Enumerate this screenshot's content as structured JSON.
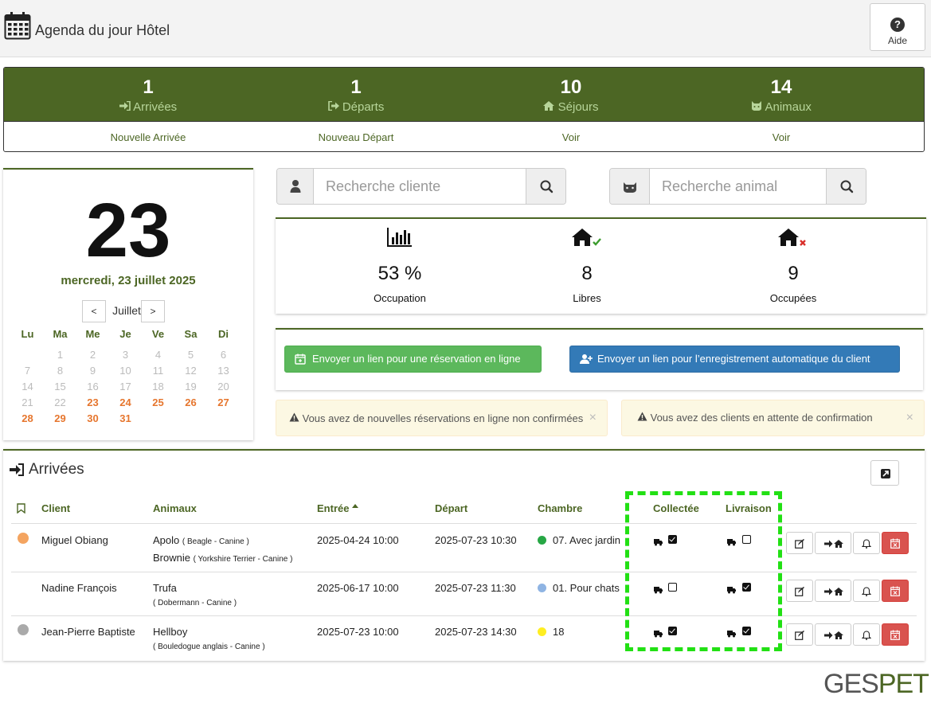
{
  "header": {
    "title": "Agenda du jour Hôtel",
    "help_label": "Aide"
  },
  "stats": [
    {
      "count": "1",
      "label": "Arrivées",
      "link": "Nouvelle Arrivée",
      "icon": "sign-in-icon"
    },
    {
      "count": "1",
      "label": "Départs",
      "link": "Nouveau Départ",
      "icon": "sign-out-icon"
    },
    {
      "count": "10",
      "label": "Séjours",
      "link": "Voir",
      "icon": "home-icon"
    },
    {
      "count": "14",
      "label": "Animaux",
      "link": "Voir",
      "icon": "cat-icon"
    }
  ],
  "calendar": {
    "big_day": "23",
    "full_date": "mercredi, 23 juillet 2025",
    "month": "Juillet",
    "prev": "<",
    "next": ">",
    "weekdays": [
      "Lu",
      "Ma",
      "Me",
      "Je",
      "Ve",
      "Sa",
      "Di"
    ],
    "days": [
      "1",
      "2",
      "3",
      "4",
      "5",
      "6",
      "7",
      "8",
      "9",
      "10",
      "11",
      "12",
      "13",
      "14",
      "15",
      "16",
      "17",
      "18",
      "19",
      "20",
      "21",
      "22",
      "23",
      "24",
      "25",
      "26",
      "27",
      "28",
      "29",
      "30",
      "31"
    ],
    "first_weekday_offset": 1,
    "first_highlighted_day": 23
  },
  "search": {
    "client_placeholder": "Recherche cliente",
    "animal_placeholder": "Recherche animal"
  },
  "occupancy": [
    {
      "value": "53 %",
      "label": "Occupation",
      "icon": "bar-chart-icon"
    },
    {
      "value": "8",
      "label": "Libres",
      "icon": "home-check-icon"
    },
    {
      "value": "9",
      "label": "Occupées",
      "icon": "home-cross-icon"
    }
  ],
  "links": {
    "online_booking": "Envoyer un lien pour une réservation en ligne",
    "client_registration": "Envoyer un lien pour l’enregistrement automatique du client"
  },
  "alerts": {
    "pending_online": "Vous avez de nouvelles réservations en ligne non confirmées",
    "pending_clients": "Vous avez des clients en attente de confirmation",
    "close": "×"
  },
  "arrivals": {
    "title": "Arrivées",
    "columns": {
      "client": "Client",
      "animals": "Animaux",
      "entry": "Entrée",
      "departure": "Départ",
      "room": "Chambre",
      "collected": "Collectée",
      "delivery": "Livraison"
    },
    "rows": [
      {
        "client": "Miguel Obiang",
        "client_dot": "#f4a460",
        "animals": [
          {
            "name": "Apolo",
            "breed": "( Beagle - Canine )"
          },
          {
            "name": "Brownie",
            "breed": "( Yorkshire Terrier - Canine )"
          }
        ],
        "entry": "2025-04-24 10:00",
        "departure": "2025-07-23 10:30",
        "room": "07. Avec jardin",
        "room_dot": "#27a745",
        "collected": true,
        "delivered": false
      },
      {
        "client": "Nadine François",
        "client_dot": "",
        "animals": [
          {
            "name": "Trufa",
            "breed": "( Dobermann - Canine )"
          }
        ],
        "entry": "2025-06-17 10:00",
        "departure": "2025-07-23 11:30",
        "room": "01. Pour chats",
        "room_dot": "#8fb4e3",
        "collected": false,
        "delivered": true
      },
      {
        "client": "Jean-Pierre Baptiste",
        "client_dot": "#aaaaaa",
        "animals": [
          {
            "name": "Hellboy",
            "breed": "( Bouledogue anglais - Canine )"
          }
        ],
        "entry": "2025-07-23 10:00",
        "departure": "2025-07-23 14:30",
        "room": "18",
        "room_dot": "#ffee22",
        "collected": true,
        "delivered": true
      }
    ]
  },
  "logo": {
    "part1": "GES",
    "part2": "PET"
  },
  "colors": {
    "brand_green": "#4c6624",
    "highlight": "#22e014",
    "accent_orange": "#e6762e"
  }
}
